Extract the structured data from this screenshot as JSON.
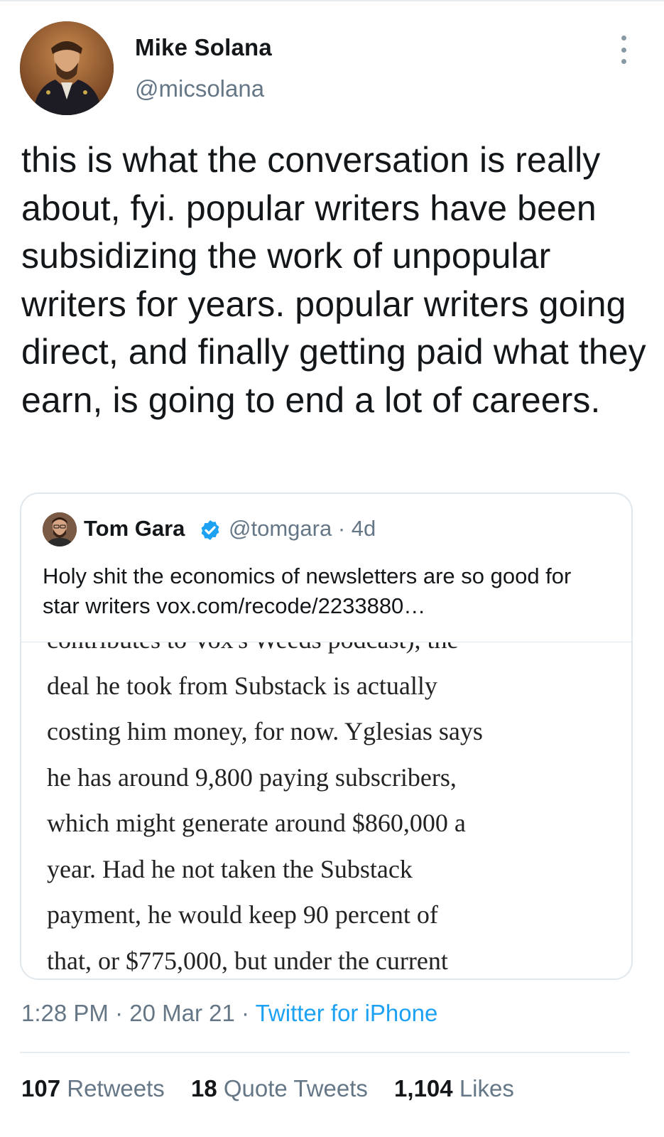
{
  "author": {
    "name": "Mike Solana",
    "handle": "@micsolana"
  },
  "tweet": {
    "text": "this is what the conversation is really about, fyi. popular writers have been subsidizing the work of unpopular writers for years. popular writers going direct, and finally getting paid what they earn, is going to end a lot of careers."
  },
  "quoted_tweet": {
    "name": "Tom Gara",
    "handle": "@tomgara",
    "age": "4d",
    "text": "Holy shit the economics of newsletters are so good for star writers ",
    "link": "vox.com/recode/2233880…",
    "image_text": "contributes to Vox's Weeds podcast), the\ndeal he took from Substack is actually\ncosting him money, for now. Yglesias says\nhe has around 9,800 paying subscribers,\nwhich might generate around $860,000 a\nyear. Had he not taken the Substack\npayment, he would keep 90 percent of\nthat, or $775,000, but under the current"
  },
  "meta": {
    "time": "1:28 PM",
    "date": "20 Mar 21",
    "source": "Twitter for iPhone"
  },
  "stats": {
    "retweets": {
      "count": "107",
      "label": "Retweets"
    },
    "quotes": {
      "count": "18",
      "label": "Quote Tweets"
    },
    "likes": {
      "count": "1,104",
      "label": "Likes"
    }
  },
  "colors": {
    "accent": "#1da1f2",
    "secondary_text": "#657786",
    "verified": "#1da1f2"
  },
  "icons": [
    "more-icon",
    "verified-badge-icon"
  ]
}
